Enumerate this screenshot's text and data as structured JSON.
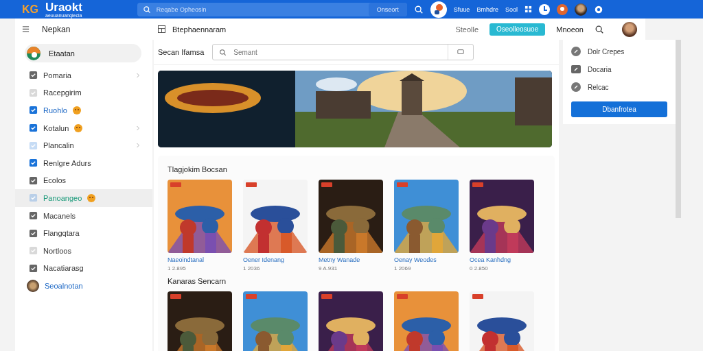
{
  "topbar": {
    "logo_mark": "KG",
    "logo": "Uraokt",
    "logo_tagline": "aeuuanuanqiecia",
    "search": {
      "placeholder": "Reqabe Opheosin"
    },
    "search_button": "Onseort",
    "nav": [
      "Sfuue",
      "Bmhdre",
      "Sool"
    ]
  },
  "header": {
    "menu_label": "Nepkan",
    "page_title": "Btephaennaram",
    "links": [
      "Steolle",
      "Mnoeon"
    ],
    "primary_button": "Oseolleosuoe"
  },
  "sidebar": {
    "profile": "Etaatan",
    "items": [
      {
        "label": "Pomaria",
        "chevron": true,
        "badge": false,
        "selected": false,
        "kind": "plain"
      },
      {
        "label": "Racepgirim",
        "chevron": false,
        "badge": false,
        "selected": false,
        "kind": "plain"
      },
      {
        "label": "Ruohlo",
        "chevron": false,
        "badge": true,
        "selected": false,
        "kind": "link"
      },
      {
        "label": "Kotalun",
        "chevron": true,
        "badge": true,
        "selected": false,
        "kind": "plain"
      },
      {
        "label": "Plancalin",
        "chevron": true,
        "badge": false,
        "selected": false,
        "kind": "plain"
      },
      {
        "label": "Renlgre Adurs",
        "chevron": false,
        "badge": false,
        "selected": false,
        "kind": "plain"
      },
      {
        "label": "Ecolos",
        "chevron": false,
        "badge": false,
        "selected": false,
        "kind": "plain"
      },
      {
        "label": "Panoangeo",
        "chevron": false,
        "badge": true,
        "selected": true,
        "kind": "plain"
      },
      {
        "label": "Macanels",
        "chevron": false,
        "badge": false,
        "selected": false,
        "kind": "plain"
      },
      {
        "label": "Flangqtara",
        "chevron": false,
        "badge": false,
        "selected": false,
        "kind": "plain"
      },
      {
        "label": "Nortloos",
        "chevron": false,
        "badge": false,
        "selected": false,
        "kind": "plain"
      },
      {
        "label": "Nacatiarasg",
        "chevron": false,
        "badge": false,
        "selected": false,
        "kind": "plain"
      },
      {
        "label": "Seoalnotan",
        "chevron": false,
        "badge": false,
        "selected": false,
        "kind": "user"
      }
    ]
  },
  "search_row": {
    "label": "Secan Ifamsa",
    "field": {
      "placeholder": "Semant"
    }
  },
  "sections": [
    {
      "title": "Tlagjokim Bocsan",
      "games": [
        {
          "title": "Naeoindtanal",
          "count": "1 2.895"
        },
        {
          "title": "Oener Idenang",
          "count": "1 2036"
        },
        {
          "title": "Metny Wanade",
          "count": "9 A.931"
        },
        {
          "title": "Oenay Weodes",
          "count": "1 2069"
        },
        {
          "title": "Ocea Kanhdng",
          "count": "0 2.850"
        }
      ]
    },
    {
      "title": "Kanaras Sencarn"
    }
  ],
  "side_panel": {
    "items": [
      "Dolr Crepes",
      "Docaria",
      "Relcac"
    ],
    "button": "Dbanfrotea"
  }
}
